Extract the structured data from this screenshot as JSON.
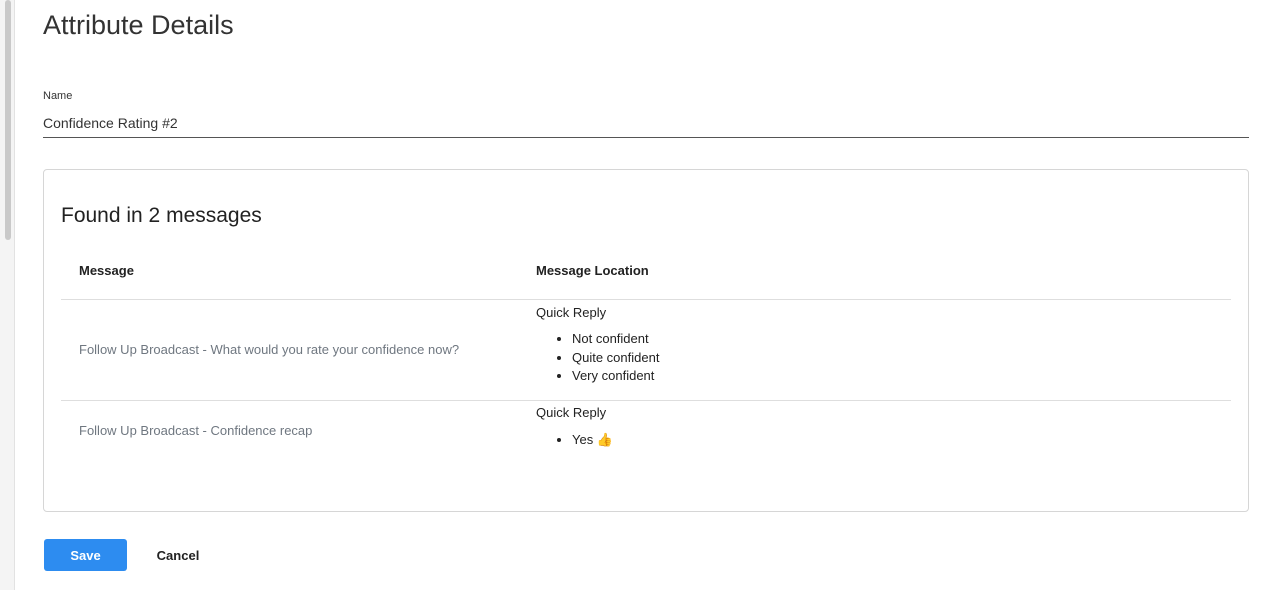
{
  "page": {
    "title": "Attribute Details"
  },
  "form": {
    "name_label": "Name",
    "name_value": "Confidence Rating #2"
  },
  "usage": {
    "heading": "Found in 2 messages",
    "columns": {
      "message": "Message",
      "location": "Message Location"
    },
    "rows": [
      {
        "message": "Follow Up Broadcast - What would you rate your confidence now?",
        "location_title": "Quick Reply",
        "items": [
          "Not confident",
          "Quite confident",
          "Very confident"
        ]
      },
      {
        "message": "Follow Up Broadcast - Confidence recap",
        "location_title": "Quick Reply",
        "items": [
          "Yes 👍"
        ]
      }
    ]
  },
  "actions": {
    "save_label": "Save",
    "cancel_label": "Cancel"
  },
  "colors": {
    "primary": "#2d8cf0",
    "link_muted": "#6f7780"
  }
}
